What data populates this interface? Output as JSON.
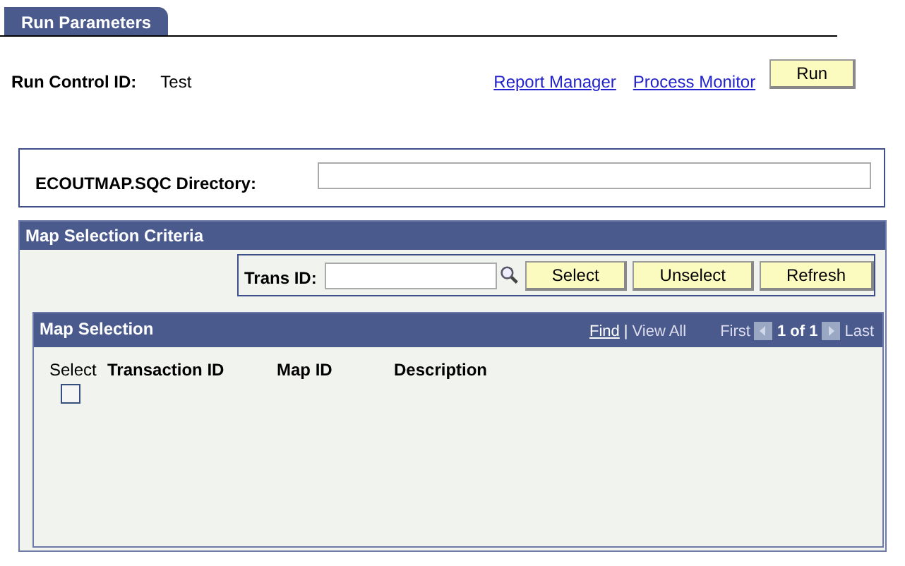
{
  "tab": {
    "label": "Run Parameters",
    "selected": true
  },
  "run_control": {
    "label": "Run Control ID:",
    "value": "Test"
  },
  "links": [
    "Report Manager",
    "Process Monitor"
  ],
  "run_button": "Run",
  "directory": {
    "label": "ECOUTMAP.SQC Directory:"
  },
  "criteria": {
    "title": "Map Selection Criteria",
    "trans_id_label": "Trans ID:",
    "buttons": [
      "Select",
      "Unselect",
      "Refresh"
    ]
  },
  "grid": {
    "title": "Map Selection",
    "nav": {
      "find": "Find",
      "separator": "|",
      "view_all": "View All",
      "first": "First",
      "range": "1 of 1",
      "last": "Last"
    },
    "columns": [
      {
        "label": "Select",
        "kind": "plain"
      },
      {
        "label": "Transaction ID",
        "kind": "bold"
      },
      {
        "label": "Map ID",
        "kind": "bold"
      },
      {
        "label": "Description",
        "kind": "bold"
      }
    ],
    "rows": [
      {
        "checked": false
      }
    ]
  }
}
